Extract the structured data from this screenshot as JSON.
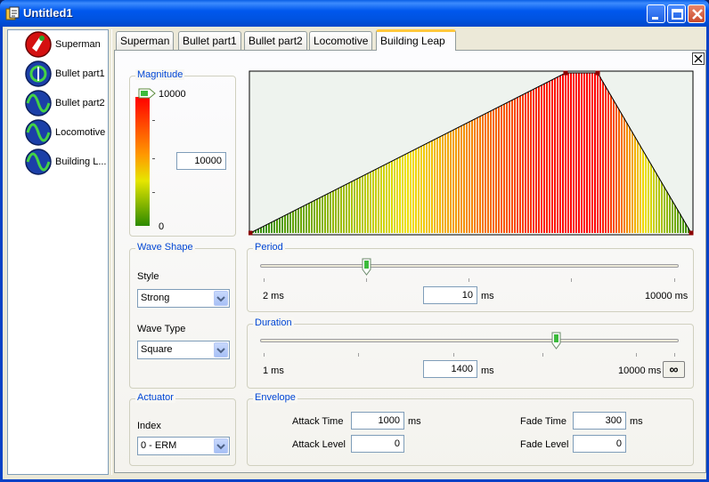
{
  "window": {
    "title": "Untitled1"
  },
  "effects": [
    {
      "label": "Superman",
      "icon": "superman-effect-icon"
    },
    {
      "label": "Bullet part1",
      "icon": "bullet-wave-icon"
    },
    {
      "label": "Bullet part2",
      "icon": "sine-wave-icon"
    },
    {
      "label": "Locomotive",
      "icon": "sine-wave-icon"
    },
    {
      "label": "Building L...",
      "icon": "sine-wave-icon"
    }
  ],
  "tabs": [
    "Superman",
    "Bullet part1",
    "Bullet part2",
    "Locomotive",
    "Building Leap"
  ],
  "active_tab": 4,
  "magnitude": {
    "title": "Magnitude",
    "max_label": "10000",
    "min_label": "0",
    "value": "10000",
    "level": 1.0
  },
  "wave_shape": {
    "title": "Wave Shape",
    "style_label": "Style",
    "style_value": "Strong",
    "wave_type_label": "Wave Type",
    "wave_type_value": "Square"
  },
  "actuator": {
    "title": "Actuator",
    "index_label": "Index",
    "index_value": "0 - ERM"
  },
  "period": {
    "title": "Period",
    "min_label": "2 ms",
    "max_label": "10000 ms",
    "value": "10",
    "unit": "ms",
    "slider_fraction": 0.25
  },
  "duration": {
    "title": "Duration",
    "min_label": "1 ms",
    "max_label": "10000 ms",
    "value": "1400",
    "unit": "ms",
    "slider_fraction": 0.7,
    "infinite_button": "∞"
  },
  "envelope": {
    "title": "Envelope",
    "attack_time_label": "Attack Time",
    "attack_time_value": "1000",
    "attack_time_unit": "ms",
    "attack_level_label": "Attack Level",
    "attack_level_value": "0",
    "fade_time_label": "Fade Time",
    "fade_time_value": "300",
    "fade_time_unit": "ms",
    "fade_level_label": "Fade Level",
    "fade_level_value": "0"
  },
  "colors": {
    "title_bar": "#0058ee",
    "group_title": "#0046d5",
    "graph_bg": "#eef3ee",
    "wave_low": "#2e8b00",
    "wave_mid": "#f0e000",
    "wave_high": "#ff0000"
  }
}
